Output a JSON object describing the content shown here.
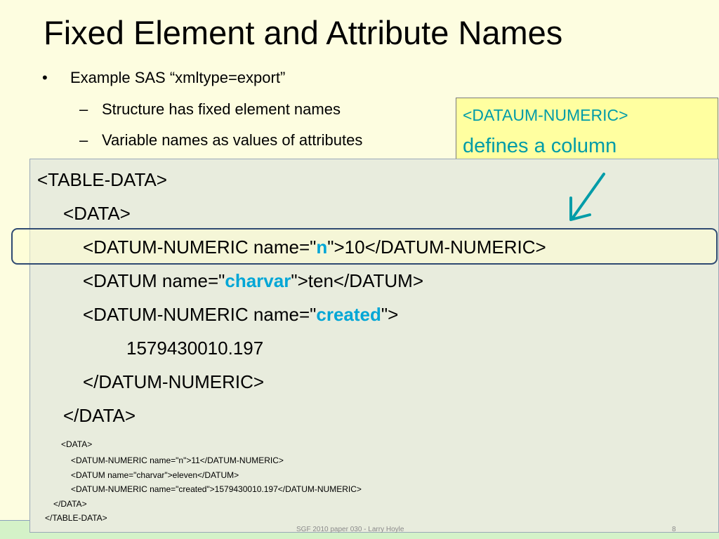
{
  "slide": {
    "title": "Fixed Element and Attribute Names",
    "bullets": {
      "level1": "Example SAS “xmltype=export”",
      "level2": [
        "Structure has fixed element names",
        "Variable names as values of attributes"
      ],
      "bullet_char": "•",
      "dash_char": "–"
    },
    "callout": {
      "line1": "<DATAUM-NUMERIC>",
      "line2": "defines a column",
      "color": "#009ca8"
    }
  },
  "code": {
    "highlight_color": "#00a6d6",
    "lines": [
      "<TABLE-DATA>",
      "<DATA>",
      {
        "before": "<DATUM-NUMERIC name=\"",
        "name": "n",
        "after": "\">10</DATUM-NUMERIC>"
      },
      {
        "before": "<DATUM name=\"",
        "name": "charvar",
        "after": "\">ten</DATUM>"
      },
      {
        "before": "<DATUM-NUMERIC name=\"",
        "name": "created",
        "after": "\">"
      },
      "1579430010.197",
      "</DATUM-NUMERIC>",
      "</DATA>"
    ],
    "small_lines": [
      "<DATA>",
      "<DATUM-NUMERIC name=\"n\">11</DATUM-NUMERIC>",
      "<DATUM name=\"charvar\">eleven</DATUM>",
      "<DATUM-NUMERIC name=\"created\">1579430010.197</DATUM-NUMERIC>",
      "</DATA>",
      "</TABLE-DATA>"
    ]
  },
  "footer": {
    "text": "SGF 2010 paper  030  - Larry Hoyle",
    "page_number": "8"
  }
}
